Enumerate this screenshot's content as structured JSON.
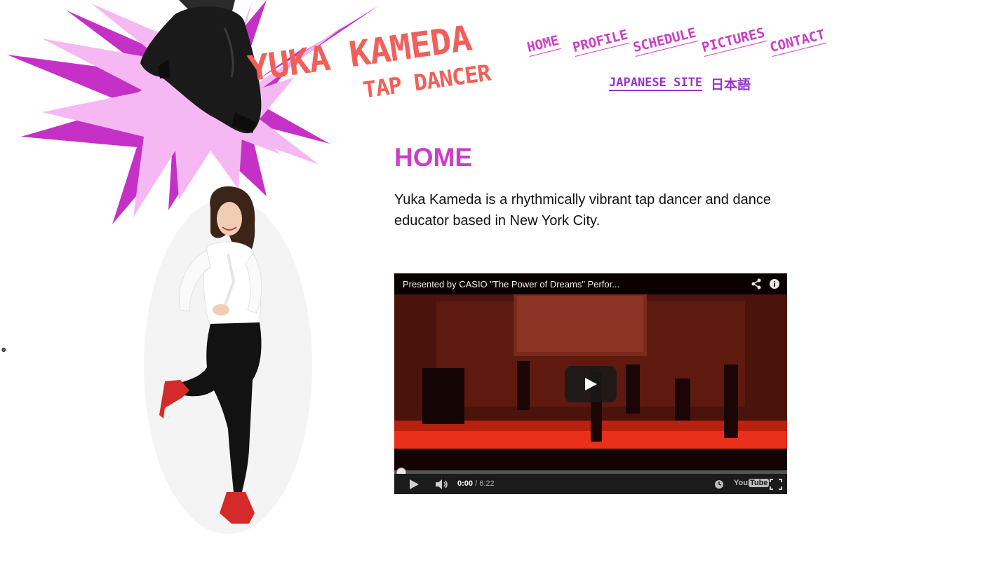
{
  "brand": {
    "name": "YUKA KAMEDA",
    "tagline": "TAP DANCER",
    "colors": {
      "accent": "#cc3dc8",
      "logo": "#f0605a",
      "burst_light": "#f6b8f3",
      "burst_dark": "#c531c7",
      "japanese_link": "#9933cc"
    }
  },
  "nav": {
    "items": [
      {
        "label": "HOME"
      },
      {
        "label": "PROFILE"
      },
      {
        "label": "SCHEDULE"
      },
      {
        "label": "PICTURES"
      },
      {
        "label": "CONTACT"
      }
    ],
    "japanese_link": "JAPANESE SITE",
    "japanese_text": "日本語"
  },
  "main": {
    "title": "HOME",
    "intro": "Yuka Kameda is a rhythmically vibrant tap dancer and dance educator based in New York City."
  },
  "video": {
    "title": "Presented by CASIO \"The Power of Dreams\" Perfor...",
    "current_time": "0:00",
    "separator": "/",
    "duration": "6:22",
    "progress": 0,
    "platform_you": "You",
    "platform_tube": "Tube",
    "icons": [
      "share-icon",
      "info-icon",
      "play-icon",
      "volume-icon",
      "clock-icon",
      "fullscreen-icon"
    ]
  }
}
